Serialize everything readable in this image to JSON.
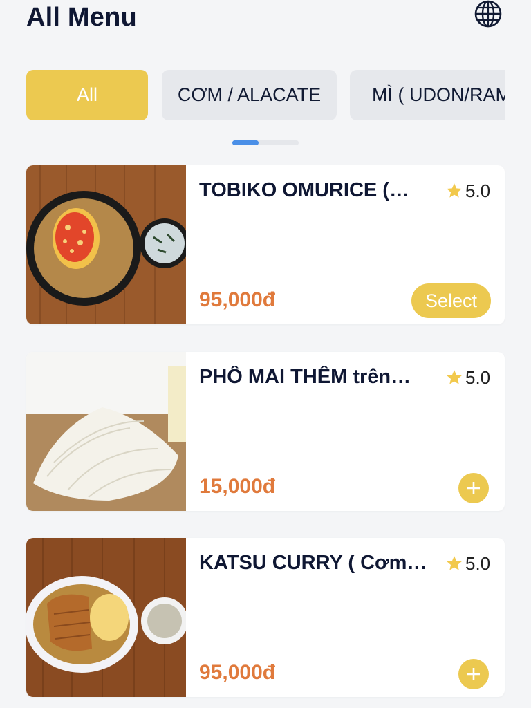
{
  "header": {
    "title": "All Menu",
    "language_icon": "globe-icon"
  },
  "categories": [
    {
      "label": "All",
      "active": true
    },
    {
      "label": "CƠM / ALACATE",
      "active": false
    },
    {
      "label": "MÌ ( UDON/RAM",
      "active": false
    }
  ],
  "colors": {
    "accent": "#ecc950",
    "price": "#e07a3c",
    "indicator": "#4a8fe7",
    "star": "#f2c94c"
  },
  "items": [
    {
      "name": "TOBIKO OMURICE (…",
      "rating": "5.0",
      "price": "95,000đ",
      "action": "Select",
      "action_type": "select-button"
    },
    {
      "name": "PHÔ MAI THÊM trên…",
      "rating": "5.0",
      "price": "15,000đ",
      "action_type": "add-icon"
    },
    {
      "name": "KATSU CURRY ( Cơm…",
      "rating": "5.0",
      "price": "95,000đ",
      "action_type": "add-icon"
    }
  ]
}
